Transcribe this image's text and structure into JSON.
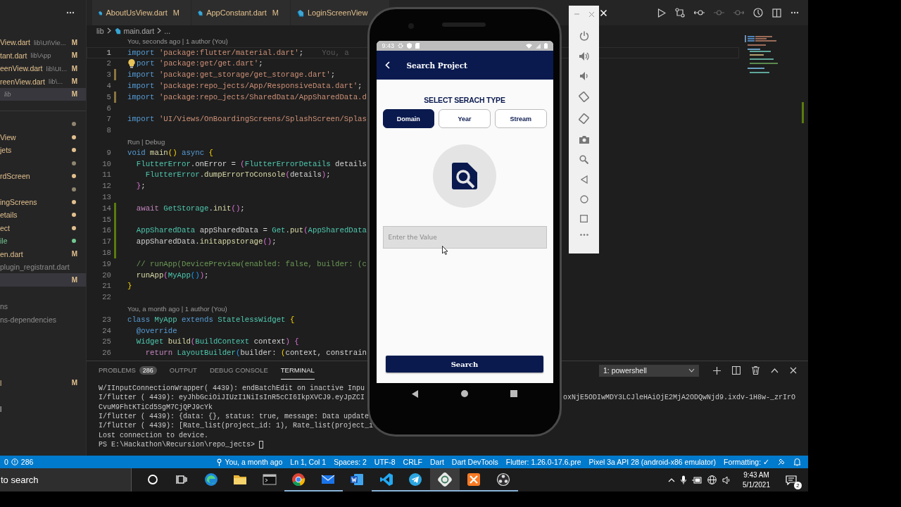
{
  "sidebar": {
    "open_editors": [
      {
        "name": "View.dart",
        "path": "lib\\UI\\Vie...",
        "badge": "M",
        "color": "#e2c08d",
        "selected": false
      },
      {
        "name": "tant.dart",
        "path": "lib\\App",
        "badge": "M",
        "color": "#e2c08d",
        "selected": false
      },
      {
        "name": "eenView.dart",
        "path": "lib\\UI...",
        "badge": "M",
        "color": "#e2c08d",
        "selected": false
      },
      {
        "name": "reenView.dart",
        "path": "lib\\...",
        "badge": "M",
        "color": "#e2c08d",
        "selected": false
      },
      {
        "path": "lib",
        "badge": "M",
        "color": "#e2c08d",
        "selected": true
      }
    ],
    "files": [
      {
        "dot": true,
        "color": "#8f8670",
        "selected": false
      },
      {
        "name": "View",
        "dot": true,
        "color": "#e2c08d",
        "selected": false
      },
      {
        "name": "jets",
        "dot": true,
        "color": "#e2c08d",
        "selected": false
      },
      {
        "dot": true,
        "color": "#8f8670",
        "selected": false
      },
      {
        "name": "rdScreen",
        "dot": true,
        "color": "#e2c08d",
        "selected": false
      },
      {
        "dot": true,
        "color": "#8f8670",
        "selected": false
      },
      {
        "name": "ingScreens",
        "dot": true,
        "color": "#e2c08d",
        "selected": false
      },
      {
        "name": "etails",
        "dot": true,
        "color": "#e2c08d",
        "selected": false
      },
      {
        "name": "ect",
        "dot": true,
        "color": "#e2c08d",
        "selected": false
      },
      {
        "name": "ile",
        "dot": true,
        "color": "#73c991",
        "selected": false
      },
      {
        "name": "en.dart",
        "badge": "M",
        "color": "#e2c08d",
        "selected": false
      },
      {
        "name": "plugin_registrant.dart",
        "color": "#8c8c8c",
        "selected": false
      },
      {
        "badge": "M",
        "color": "#e2c08d",
        "selected": true
      }
    ],
    "outline": [
      {
        "name": "ns",
        "color": "#8c8c8c",
        "selected": false
      },
      {
        "name": "ns-dependencies",
        "color": "#8c8c8c",
        "selected": false
      }
    ],
    "lower": [
      {
        "name": "l",
        "badge": "M",
        "color": "#e2c08d",
        "selected": false
      },
      {
        "name": "l",
        "selected": false
      }
    ]
  },
  "editor_tabs": [
    {
      "label": "AboutUsView.dart",
      "badge": "M",
      "selected": false
    },
    {
      "label": "AppConstant.dart",
      "badge": "M",
      "selected": false
    },
    {
      "label": "LoginScreenView",
      "selected": false
    }
  ],
  "breadcrumb": [
    "lib",
    "main.dart",
    "..."
  ],
  "code": [
    {
      "kind": "lens",
      "text": "You, seconds ago | 1 author (You)"
    },
    {
      "kind": "code",
      "number": "1",
      "current": true,
      "blame": "You, a",
      "tokens": [
        {
          "text": "import ",
          "kind": "kw"
        },
        {
          "text": "'package:flutter/material.dart'",
          "kind": "str"
        },
        {
          "text": ";",
          "kind": "p"
        }
      ]
    },
    {
      "kind": "code",
      "number": "2",
      "bulb": true,
      "tokens": [
        {
          "text": "port ",
          "kind": "kw"
        },
        {
          "text": "'package:get/get.dart'",
          "kind": "str"
        },
        {
          "text": ";",
          "kind": "p"
        }
      ]
    },
    {
      "kind": "code",
      "number": "3",
      "color": "#8a7440",
      "tokens": [
        {
          "text": "import ",
          "kind": "kw"
        },
        {
          "text": "'package:get_storage/get_storage.dart'",
          "kind": "str"
        },
        {
          "text": ";",
          "kind": "p"
        }
      ]
    },
    {
      "kind": "code",
      "number": "4",
      "tokens": [
        {
          "text": "import ",
          "kind": "kw"
        },
        {
          "text": "'package:repo_jects/App/ResponsiveData.dart'",
          "kind": "str"
        },
        {
          "text": ";",
          "kind": "p"
        }
      ]
    },
    {
      "kind": "code",
      "number": "5",
      "color": "#8a7440",
      "tokens": [
        {
          "text": "import ",
          "kind": "kw"
        },
        {
          "text": "'package:repo_jects/SharedData/AppSharedData.d",
          "kind": "str"
        }
      ]
    },
    {
      "kind": "code",
      "number": "6"
    },
    {
      "kind": "code",
      "number": "7",
      "tokens": [
        {
          "text": "import ",
          "kind": "kw"
        },
        {
          "text": "'UI/Views/OnBoardingScreens/SplashScreen/Splas",
          "kind": "str"
        }
      ]
    },
    {
      "kind": "code",
      "number": "8"
    },
    {
      "kind": "lens",
      "text": "Run | Debug"
    },
    {
      "kind": "code",
      "number": "9",
      "tokens": [
        {
          "text": "void ",
          "kind": "kw"
        },
        {
          "text": "main",
          "kind": "fn"
        },
        {
          "text": "()",
          "kind": "b1"
        },
        {
          "text": " async ",
          "kind": "kw"
        },
        {
          "text": "{",
          "kind": "b1"
        }
      ]
    },
    {
      "kind": "code",
      "number": "10",
      "tokens": [
        {
          "text": "  FlutterError",
          "kind": "type"
        },
        {
          "text": ".onError = ",
          "kind": "p"
        },
        {
          "text": "(",
          "kind": "b2"
        },
        {
          "text": "FlutterErrorDetails ",
          "kind": "type"
        },
        {
          "text": "details",
          "kind": "p"
        }
      ]
    },
    {
      "kind": "code",
      "number": "11",
      "tokens": [
        {
          "text": "    FlutterError",
          "kind": "type"
        },
        {
          "text": ".",
          "kind": "p"
        },
        {
          "text": "dumpErrorToConsole",
          "kind": "fn"
        },
        {
          "text": "(",
          "kind": "b2"
        },
        {
          "text": "details",
          "kind": "p"
        },
        {
          "text": ")",
          "kind": "b2"
        },
        {
          "text": ";",
          "kind": "p"
        }
      ]
    },
    {
      "kind": "code",
      "number": "12",
      "tokens": [
        {
          "text": "  }",
          "kind": "b2"
        },
        {
          "text": ";",
          "kind": "p"
        }
      ]
    },
    {
      "kind": "code",
      "number": "13"
    },
    {
      "kind": "code",
      "number": "14",
      "color": "#587c0c",
      "tokens": [
        {
          "text": "  await ",
          "kind": "ctl"
        },
        {
          "text": "GetStorage",
          "kind": "type"
        },
        {
          "text": ".",
          "kind": "p"
        },
        {
          "text": "init",
          "kind": "fn"
        },
        {
          "text": "()",
          "kind": "b2"
        },
        {
          "text": ";",
          "kind": "p"
        }
      ]
    },
    {
      "kind": "code",
      "number": "15",
      "color": "#587c0c"
    },
    {
      "kind": "code",
      "number": "16",
      "color": "#587c0c",
      "tokens": [
        {
          "text": "  AppSharedData ",
          "kind": "type"
        },
        {
          "text": "appSharedData = ",
          "kind": "p"
        },
        {
          "text": "Get",
          "kind": "type"
        },
        {
          "text": ".",
          "kind": "p"
        },
        {
          "text": "put",
          "kind": "fn"
        },
        {
          "text": "(",
          "kind": "b2"
        },
        {
          "text": "AppSharedData",
          "kind": "type"
        }
      ]
    },
    {
      "kind": "code",
      "number": "17",
      "color": "#587c0c",
      "tokens": [
        {
          "text": "  appSharedData.",
          "kind": "p"
        },
        {
          "text": "initappstorage",
          "kind": "fn"
        },
        {
          "text": "()",
          "kind": "b2"
        },
        {
          "text": ";",
          "kind": "p"
        }
      ]
    },
    {
      "kind": "code",
      "number": "18",
      "color": "#587c0c"
    },
    {
      "kind": "code",
      "number": "19",
      "tokens": [
        {
          "text": "  // runApp(DevicePreview(enabled: false, builder: (c",
          "kind": "com"
        }
      ]
    },
    {
      "kind": "code",
      "number": "20",
      "tokens": [
        {
          "text": "  runApp",
          "kind": "fn"
        },
        {
          "text": "(",
          "kind": "b2"
        },
        {
          "text": "MyApp",
          "kind": "type"
        },
        {
          "text": "()",
          "kind": "b3"
        },
        {
          "text": ")",
          "kind": "b2"
        },
        {
          "text": ";",
          "kind": "p"
        }
      ]
    },
    {
      "kind": "code",
      "number": "21",
      "tokens": [
        {
          "text": "}",
          "kind": "b1"
        }
      ]
    },
    {
      "kind": "code",
      "number": "22"
    },
    {
      "kind": "lens",
      "text": "You, a month ago | 1 author (You)"
    },
    {
      "kind": "code",
      "number": "23",
      "tokens": [
        {
          "text": "class ",
          "kind": "kw"
        },
        {
          "text": "MyApp ",
          "kind": "type"
        },
        {
          "text": "extends ",
          "kind": "kw"
        },
        {
          "text": "StatelessWidget ",
          "kind": "type"
        },
        {
          "text": "{",
          "kind": "b1"
        }
      ]
    },
    {
      "kind": "code",
      "number": "24",
      "tokens": [
        {
          "text": "  @override",
          "kind": "kw"
        }
      ]
    },
    {
      "kind": "code",
      "number": "25",
      "tokens": [
        {
          "text": "  Widget ",
          "kind": "type"
        },
        {
          "text": "build",
          "kind": "fn"
        },
        {
          "text": "(",
          "kind": "b2"
        },
        {
          "text": "BuildContext ",
          "kind": "type"
        },
        {
          "text": "context",
          "kind": "p"
        },
        {
          "text": ") ",
          "kind": "b2"
        },
        {
          "text": "{",
          "kind": "b2"
        }
      ]
    },
    {
      "kind": "code",
      "number": "26",
      "tokens": [
        {
          "text": "    return ",
          "kind": "ctl"
        },
        {
          "text": "LayoutBuilder",
          "kind": "type"
        },
        {
          "text": "(",
          "kind": "b3"
        },
        {
          "text": "builder: ",
          "kind": "p"
        },
        {
          "text": "(",
          "kind": "b1"
        },
        {
          "text": "context, constrain",
          "kind": "p"
        }
      ]
    }
  ],
  "panel": {
    "tabs": [
      {
        "label": "PROBLEMS",
        "badge": "286",
        "selected": false
      },
      {
        "label": "OUTPUT",
        "selected": false
      },
      {
        "label": "DEBUG CONSOLE",
        "selected": false
      },
      {
        "label": "TERMINAL",
        "selected": true
      }
    ],
    "terminal_select": "1: powershell",
    "lines": [
      {
        "left": "W/IInputConnectionWrapper( 4439): endBatchEdit on inactive Inpu"
      },
      {
        "left": "I/flutter ( 4439): eyJhbGciOiJIUzI1NiIsInR5cCI6IkpXVCJ9.eyJpZCI",
        "right": "oxNjE5ODIwMDY3LCJleHAiOjE2MjA2ODQwNjd9.ixdv-1H8w-_zrIrO"
      },
      {
        "left": "CvuM9FhtKTiCd5SgM7CjQPJ9cYk"
      },
      {
        "left": "I/flutter ( 4439): {data: {}, status: true, message: Data update"
      },
      {
        "left": "I/flutter ( 4439): [Rate_list(project_id: 1), Rate_list(project_i"
      },
      {
        "left": "Lost connection to device."
      },
      {
        "left": "PS E:\\Hackathon\\Recursion\\repo_jects> ",
        "prompt": true
      }
    ]
  },
  "status_bar": {
    "errors": "0",
    "warnings": "286",
    "items": [
      {
        "text": "You, a month ago",
        "kind": "blame"
      },
      {
        "text": "Ln 1, Col 1"
      },
      {
        "text": "Spaces: 2"
      },
      {
        "text": "UTF-8"
      },
      {
        "text": "CRLF"
      },
      {
        "text": "Dart"
      },
      {
        "text": "Dart DevTools"
      },
      {
        "text": "Flutter: 1.26.0-17.6.pre"
      },
      {
        "text": "Pixel 3a API 28 (android-x86 emulator)"
      },
      {
        "text": "Formatting: ✓"
      }
    ]
  },
  "taskbar": {
    "search_placeholder": "to search",
    "apps": [
      {
        "kind": "cortana",
        "running": false,
        "selected": false
      },
      {
        "kind": "taskview",
        "running": false,
        "selected": false
      },
      {
        "kind": "edge",
        "running": false,
        "selected": false
      },
      {
        "kind": "explorer",
        "running": false,
        "selected": false
      },
      {
        "kind": "terminal",
        "running": false,
        "selected": false
      },
      {
        "kind": "chrome",
        "running": true,
        "selected": false
      },
      {
        "kind": "mail",
        "running": true,
        "selected": false
      },
      {
        "kind": "word",
        "running": false,
        "selected": false
      },
      {
        "kind": "vscode",
        "running": true,
        "selected": false
      },
      {
        "kind": "telegram",
        "running": true,
        "selected": false
      },
      {
        "kind": "studio",
        "running": true,
        "selected": true
      },
      {
        "kind": "xampp",
        "running": true,
        "selected": false
      },
      {
        "kind": "obs",
        "running": true,
        "selected": false
      }
    ],
    "time": "9:43 AM",
    "date": "5/1/2021",
    "notifications": "2"
  },
  "phone": {
    "status_time": "9:43",
    "title": "Search Project",
    "section_title": "SELECT SERACH TYPE",
    "types": [
      {
        "label": "Domain",
        "selected": true
      },
      {
        "label": "Year",
        "selected": false
      },
      {
        "label": "Stream",
        "selected": false
      }
    ],
    "search_field": {
      "placeholder": "Enter the Value"
    },
    "search_button": "Search"
  }
}
